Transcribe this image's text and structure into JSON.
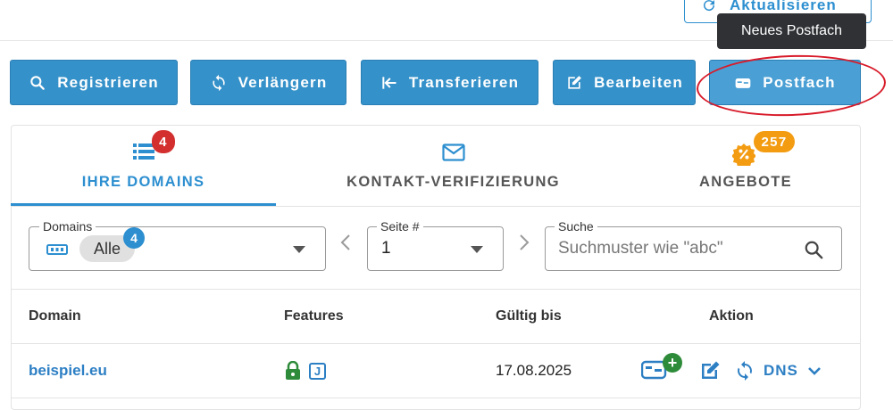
{
  "top_button": {
    "label": "Aktualisieren"
  },
  "tooltip": {
    "text": "Neues Postfach"
  },
  "toolbar": {
    "register": "Registrieren",
    "renew": "Verlängern",
    "transfer": "Transferieren",
    "edit": "Bearbeiten",
    "mailbox": "Postfach"
  },
  "tabs": {
    "domains": {
      "label": "IHRE DOMAINS",
      "badge": "4"
    },
    "contact": {
      "label": "KONTAKT-VERIFIZIERUNG"
    },
    "offers": {
      "label": "ANGEBOTE",
      "badge": "257"
    }
  },
  "filters": {
    "domains": {
      "label": "Domains",
      "chip": "Alle",
      "badge": "4"
    },
    "page": {
      "label": "Seite #",
      "value": "1"
    },
    "search": {
      "label": "Suche",
      "placeholder": "Suchmuster wie \"abc\""
    }
  },
  "table": {
    "headers": {
      "domain": "Domain",
      "features": "Features",
      "valid": "Gültig bis",
      "action": "Aktion"
    },
    "rows": [
      {
        "domain": "beispiel.eu",
        "feature_letter": "J",
        "valid_until": "17.08.2025",
        "dns": "DNS"
      }
    ]
  },
  "colors": {
    "primary": "#3591c9",
    "accent_blue": "#2d8fd0",
    "badge_red": "#d32f2f",
    "badge_orange": "#f39c12",
    "lock_green": "#2e8b3a",
    "tooltip_bg": "#2f3135",
    "highlight_ellipse": "#d81b2a"
  }
}
